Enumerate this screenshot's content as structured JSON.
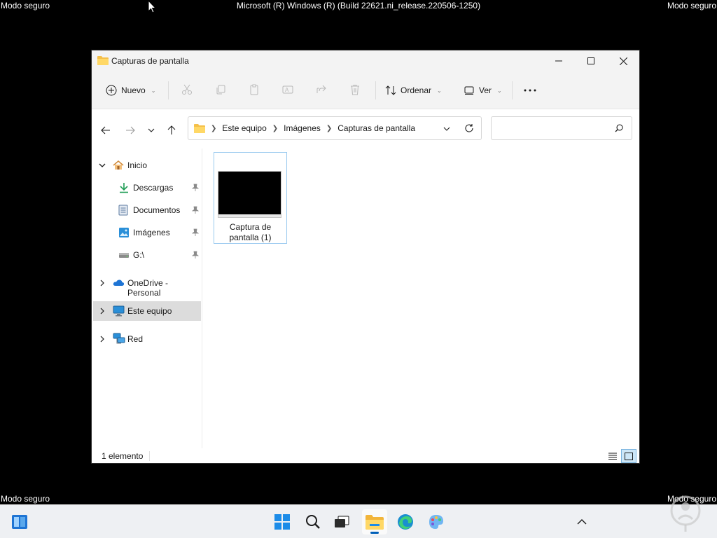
{
  "screen": {
    "safe_mode_label": "Modo seguro",
    "build_label": "Microsoft (R) Windows (R) (Build 22621.ni_release.220506-1250)"
  },
  "window": {
    "title": "Capturas de pantalla",
    "folder_icon": "folder-icon"
  },
  "toolbar": {
    "new_label": "Nuevo",
    "sort_label": "Ordenar",
    "view_label": "Ver",
    "icons": [
      "cut-icon",
      "copy-icon",
      "paste-icon",
      "rename-icon",
      "share-icon",
      "delete-icon",
      "more-icon"
    ]
  },
  "address": {
    "breadcrumbs": [
      "Este equipo",
      "Imágenes",
      "Capturas de pantalla"
    ],
    "search_placeholder": ""
  },
  "sidebar": {
    "items": [
      {
        "label": "Inicio",
        "icon": "home-icon"
      },
      {
        "label": "Descargas",
        "icon": "download-icon",
        "pinned": true
      },
      {
        "label": "Documentos",
        "icon": "document-icon",
        "pinned": true
      },
      {
        "label": "Imágenes",
        "icon": "pictures-icon",
        "pinned": true
      },
      {
        "label": "G:\\",
        "icon": "drive-icon",
        "pinned": true
      },
      {
        "label": "OneDrive - Personal",
        "icon": "onedrive-icon"
      },
      {
        "label": "Este equipo",
        "icon": "computer-icon",
        "selected": true
      },
      {
        "label": "Red",
        "icon": "network-icon"
      }
    ]
  },
  "files": [
    {
      "name": "Captura de pantalla (1)",
      "name_line1": "Captura de",
      "name_line2": "pantalla (1)"
    }
  ],
  "status": {
    "count": "1 elemento"
  },
  "taskbar": {
    "items": [
      "widgets-icon",
      "start-icon",
      "search-icon",
      "task-view-icon",
      "file-explorer-icon",
      "edge-icon",
      "paint-icon",
      "chevron-up-icon"
    ]
  },
  "colors": {
    "accent": "#005fb8",
    "selection": "#dcdcdc",
    "tile_border": "#99c9ef"
  }
}
